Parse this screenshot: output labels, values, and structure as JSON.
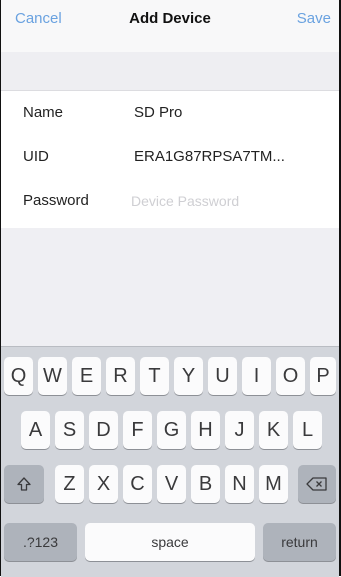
{
  "nav": {
    "cancel_label": "Cancel",
    "title": "Add Device",
    "save_label": "Save"
  },
  "form": {
    "name": {
      "label": "Name",
      "value": "SD Pro"
    },
    "uid": {
      "label": "UID",
      "value": "ERA1G87RPSA7TM..."
    },
    "password": {
      "label": "Password",
      "placeholder": "Device Password"
    }
  },
  "keyboard": {
    "row1": [
      "Q",
      "W",
      "E",
      "R",
      "T",
      "Y",
      "U",
      "I",
      "O",
      "P"
    ],
    "row2": [
      "A",
      "S",
      "D",
      "F",
      "G",
      "H",
      "J",
      "K",
      "L"
    ],
    "row3": [
      "Z",
      "X",
      "C",
      "V",
      "B",
      "N",
      "M"
    ],
    "numbers_label": ".?123",
    "space_label": "space",
    "return_label": "return",
    "shift_icon": "shift-arrow-icon",
    "delete_icon": "backspace-icon"
  }
}
